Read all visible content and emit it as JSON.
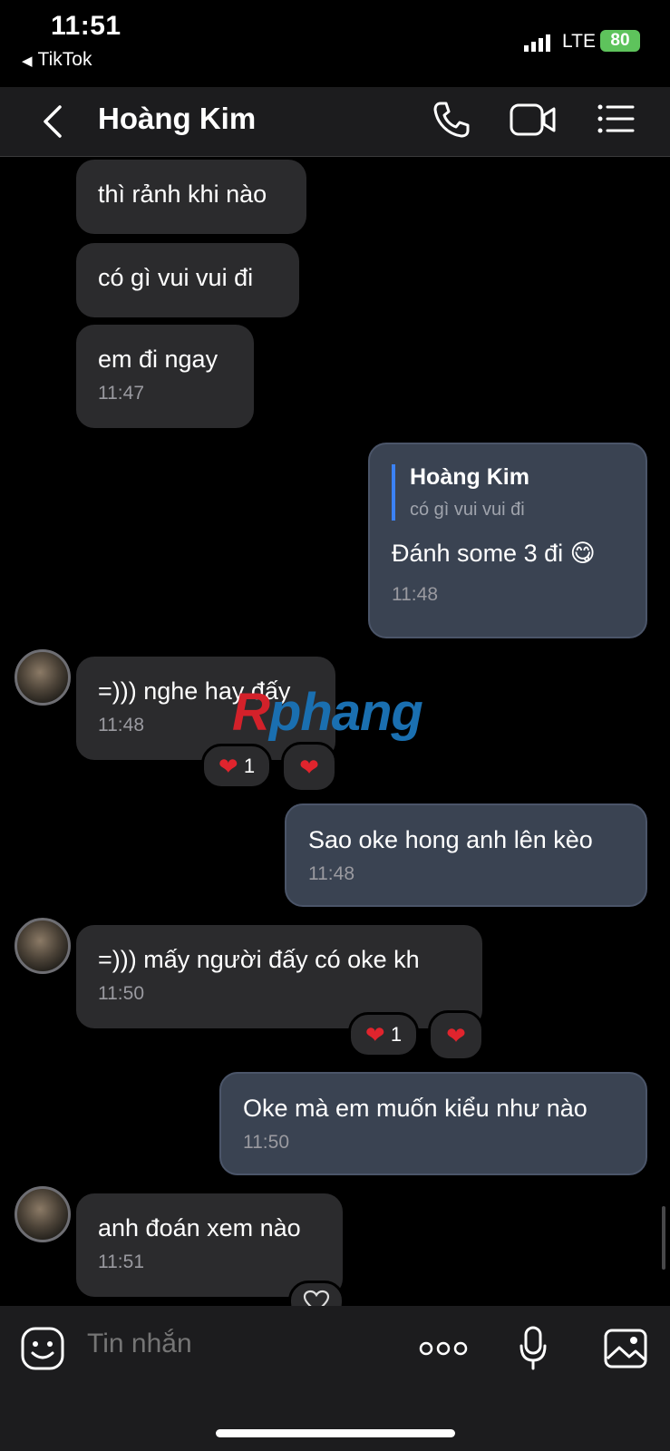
{
  "status": {
    "time": "11:51",
    "back_app": "TikTok",
    "network": "LTE",
    "battery": "80"
  },
  "header": {
    "contact_name": "Hoàng Kim"
  },
  "messages": [
    {
      "text": "thì rảnh khi nào"
    },
    {
      "text": "có gì vui vui đi"
    },
    {
      "text": "em đi ngay",
      "time": "11:47"
    },
    {
      "text": "Đánh some 3 đi 😋",
      "time": "11:48",
      "quote_name": "Hoàng Kim",
      "quote_text": "có gì vui vui đi"
    },
    {
      "text": "=))) nghe hay đấy",
      "time": "11:48",
      "reaction_count": "1"
    },
    {
      "text": "Sao oke hong anh lên kèo",
      "time": "11:48"
    },
    {
      "text": "=))) mấy người đấy có oke kh",
      "time": "11:50",
      "reaction_count": "1"
    },
    {
      "text": "Oke mà em muốn kiểu như nào",
      "time": "11:50"
    },
    {
      "text": "anh đoán xem nào",
      "time": "11:51"
    }
  ],
  "watermark": {
    "first": "R",
    "rest": "phang"
  },
  "composer": {
    "placeholder": "Tin nhắn"
  },
  "colors": {
    "accent": "#3b82f6",
    "heart": "#e0242d",
    "battery": "#5ec35c"
  }
}
